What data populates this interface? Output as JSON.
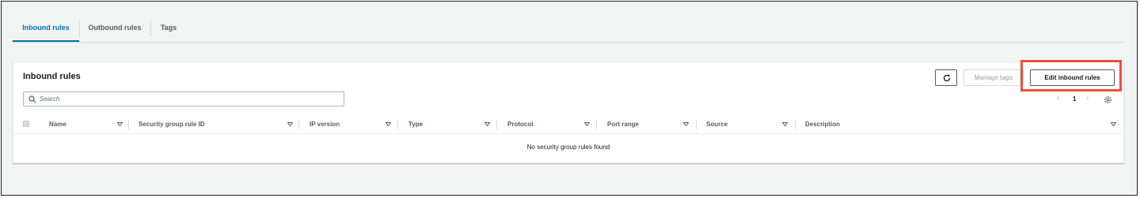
{
  "tabs": [
    {
      "label": "Inbound rules",
      "active": true
    },
    {
      "label": "Outbound rules",
      "active": false
    },
    {
      "label": "Tags",
      "active": false
    }
  ],
  "panel": {
    "title": "Inbound rules",
    "search_placeholder": "Search",
    "buttons": {
      "refresh_icon": "refresh-icon",
      "manage_tags": "Manage tags",
      "edit_inbound_rules": "Edit inbound rules"
    },
    "pagination": {
      "current_page": "1"
    },
    "columns": [
      "Name",
      "Security group rule ID",
      "IP version",
      "Type",
      "Protocol",
      "Port range",
      "Source",
      "Description"
    ],
    "empty_message": "No security group rules found"
  },
  "colors": {
    "accent": "#0073bb",
    "highlight": "#e8503a",
    "background": "#f2f3f3"
  }
}
